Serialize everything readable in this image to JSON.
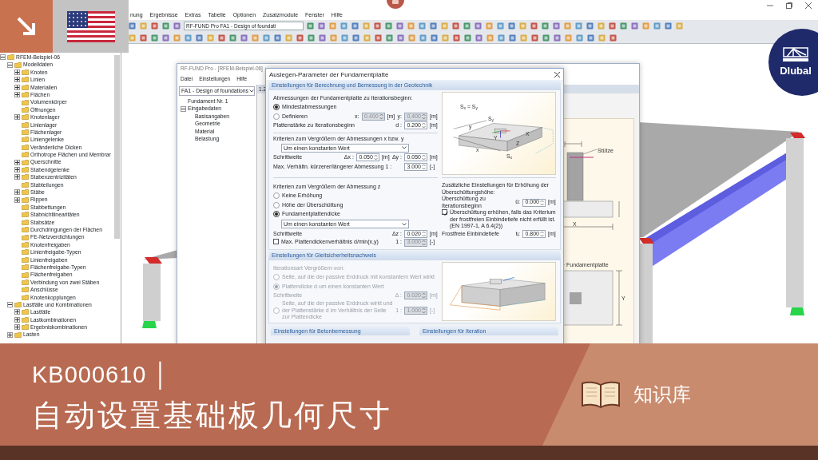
{
  "app": {
    "menu": [
      "nung",
      "Ergebnisse",
      "Extras",
      "Tabelle",
      "Optionen",
      "Zusatzmodule",
      "Fenster",
      "Hilfe"
    ],
    "module_select": "RF-FUND Pro FA1 - Design of foundati"
  },
  "navigator": {
    "tree": [
      {
        "label": "RFEM-Beispiel-06",
        "expanded": true,
        "children": [
          {
            "label": "Modelldaten",
            "expanded": true,
            "children": [
              {
                "label": "Knoten",
                "expanded": false
              },
              {
                "label": "Linien",
                "expanded": false
              },
              {
                "label": "Materialien",
                "expanded": false
              },
              {
                "label": "Flächen",
                "expanded": false
              },
              {
                "label": "Volumenkörper"
              },
              {
                "label": "Öffnungen"
              },
              {
                "label": "Knotenlager",
                "expanded": false
              },
              {
                "label": "Linienlager"
              },
              {
                "label": "Flächenlager"
              },
              {
                "label": "Liniengelenke"
              },
              {
                "label": "Veränderliche Dicken"
              },
              {
                "label": "Orthotrope Flächen und Membrar"
              },
              {
                "label": "Querschnitte",
                "expanded": false
              },
              {
                "label": "Stabendgelenke",
                "expanded": false
              },
              {
                "label": "Stabexzentrizitäten",
                "expanded": false
              },
              {
                "label": "Stabteilungen"
              },
              {
                "label": "Stäbe",
                "expanded": false
              },
              {
                "label": "Rippen",
                "expanded": false
              },
              {
                "label": "Stabbettungen"
              },
              {
                "label": "Stabnichtlinearitäten"
              },
              {
                "label": "Stabsätze"
              },
              {
                "label": "Durchdringungen der Flächen"
              },
              {
                "label": "FE-Netzverdichtungen"
              },
              {
                "label": "Knotenfreigaben"
              },
              {
                "label": "Linienfreigabe-Typen"
              },
              {
                "label": "Linienfreigaben"
              },
              {
                "label": "Flächenfreigabe-Typen"
              },
              {
                "label": "Flächenfreigaben"
              },
              {
                "label": "Verbindung von zwei Stäben"
              },
              {
                "label": "Anschlüsse"
              },
              {
                "label": "Knotenkopplungen"
              }
            ]
          },
          {
            "label": "Lastfälle und Kombinationen",
            "expanded": true,
            "children": [
              {
                "label": "Lastfälle",
                "expanded": false
              },
              {
                "label": "Lastkombinationen",
                "expanded": false
              },
              {
                "label": "Ergebniskombinationen",
                "expanded": false
              }
            ]
          },
          {
            "label": "Lasten",
            "expanded": false
          }
        ]
      }
    ]
  },
  "fund_window": {
    "title": "RF-FUND Pro - [RFEM-Beispiel-06]",
    "menu": [
      "Datei",
      "Einstellungen",
      "Hilfe"
    ],
    "case_select": "FA1 - Design of foundations",
    "tree": [
      {
        "label": "Fundament Nr. 1"
      },
      {
        "label": "Eingabedaten",
        "expanded": true,
        "children": [
          {
            "label": "Basisangaben"
          },
          {
            "label": "Geometrie"
          },
          {
            "label": "Material"
          },
          {
            "label": "Belastung"
          }
        ]
      }
    ],
    "header": "1.2",
    "figure_labels": [
      "Stütze",
      "X",
      "Fundamentplatte",
      "Y"
    ]
  },
  "dialog": {
    "title": "Auslegen-Parameter der Fundamentplatte",
    "geotech": {
      "title": "Einstellungen für Berechnung und Bemessung in der Geotechnik",
      "top_left": [
        {
          "kind": "heading",
          "text": "Abmessungen der Fundamentplatte zu Iterationsbeginn:"
        },
        {
          "kind": "radio",
          "label": "Mindestabmessungen",
          "selected": true
        },
        {
          "kind": "radio",
          "label": "Definieren",
          "selected": false,
          "inputs": [
            {
              "symbol": "x:",
              "value": "0.400",
              "unit": "[m]",
              "disabled": true
            },
            {
              "symbol": "y:",
              "value": "0.400",
              "unit": "[m]",
              "disabled": true
            }
          ]
        },
        {
          "kind": "field",
          "label": "Plattenstärke zu Iterationsbeginn",
          "inputs": [
            {
              "symbol": "d :",
              "value": "0.200",
              "unit": "[m]",
              "disabled": false
            }
          ]
        },
        {
          "kind": "heading",
          "text": "Kriterien zum Vergrößern der Abmessungen x bzw. y"
        },
        {
          "kind": "select",
          "value": "Um einen konstanten Wert"
        },
        {
          "kind": "field",
          "label": "Schrittweite",
          "inputs": [
            {
              "symbol": "Δx :",
              "value": "0.050",
              "unit": "[m]",
              "disabled": false
            },
            {
              "symbol": "Δy :",
              "value": "0.050",
              "unit": "[m]",
              "disabled": false
            }
          ]
        },
        {
          "kind": "field",
          "label": "Max. Verhältn. kürzerer/längerer Abmessung 1 :",
          "inputs": [
            {
              "value": "3.000",
              "unit": "[-]",
              "disabled": false
            }
          ]
        }
      ],
      "figure_labels": [
        "S$_{x}$ = S$_{y}$",
        "y",
        "S$_{y}$",
        "Y",
        "X",
        "Z",
        "x",
        "S$_{x}$"
      ],
      "bottom_left": [
        {
          "kind": "heading",
          "text": "Kriterien zum Vergrößern der Abmessung z"
        },
        {
          "kind": "radio",
          "label": "Keine Erhöhung",
          "selected": false
        },
        {
          "kind": "radio",
          "label": "Höhe der Überschüttung",
          "selected": false
        },
        {
          "kind": "radio",
          "label": "Fundamentplattendicke",
          "selected": true
        },
        {
          "kind": "select",
          "value": "Um einen konstanten Wert"
        },
        {
          "kind": "field",
          "label": "Schrittweite",
          "inputs": [
            {
              "symbol": "Δz :",
              "value": "0.020",
              "unit": "[m]",
              "disabled": false
            }
          ]
        },
        {
          "kind": "checkbox",
          "label": "Max. Plattendickenverhältnis d/min(x,y)",
          "checked": false,
          "inputs": [
            {
              "symbol": "1 :",
              "value": "3.000",
              "unit": "[-]",
              "disabled": true
            }
          ]
        }
      ],
      "bottom_right": [
        {
          "kind": "heading",
          "text": "Zusätzliche Einstellungen für Erhöhung der Überschüttungshöhe:"
        },
        {
          "kind": "field",
          "label": "Überschüttung zu Iterationsbeginn",
          "inputs": [
            {
              "symbol": "ü:",
              "value": "0.000",
              "unit": "[m]",
              "disabled": false
            }
          ]
        },
        {
          "kind": "checkbox",
          "label": "Überschüttung erhöhen, falls das Kriterium der frostfreien Einbindetiefe nicht erfüllt ist. (EN 1997-1, A 6.4(2))",
          "checked": true
        },
        {
          "kind": "field",
          "label": "Frostfreie Einbindetiefe",
          "inputs": [
            {
              "symbol": "t$_{f}$:",
              "value": "0.800",
              "unit": "[m]",
              "disabled": false
            }
          ]
        }
      ]
    },
    "sliding": {
      "title": "Einstellungen für Gleitsicherheitsnachweis",
      "disabled": true,
      "rows": [
        {
          "kind": "heading",
          "text": "Iterationsart Vergrößern von:"
        },
        {
          "kind": "radio",
          "label": "Seite, auf die der passive Erddruck mit konstantem Wert wirkt",
          "selected": false
        },
        {
          "kind": "radio",
          "label": "Plattendicke d um einen konstanten Wert",
          "selected": true
        },
        {
          "kind": "field",
          "label": "Schrittweite",
          "inputs": [
            {
              "symbol": "Δ :",
              "value": "0.020",
              "unit": "[m]",
              "disabled": true
            }
          ]
        },
        {
          "kind": "radio",
          "label": "Seite, auf die der passive Erddruck wirkt und der Plattenstärke d im Verhältnis der Seite zur Plattendicke",
          "selected": false,
          "inputs": [
            {
              "symbol": "1 :",
              "value": "1.000",
              "unit": "[-]",
              "disabled": true
            }
          ]
        }
      ]
    },
    "more_sections": [
      "Einstellungen für Betonbemessung",
      "Einstellungen für Iteration"
    ]
  },
  "logo": "Dlubal",
  "banner": {
    "code": "KB000610 │",
    "title": "自动设置基础板几何尺寸",
    "category": "知识库"
  }
}
